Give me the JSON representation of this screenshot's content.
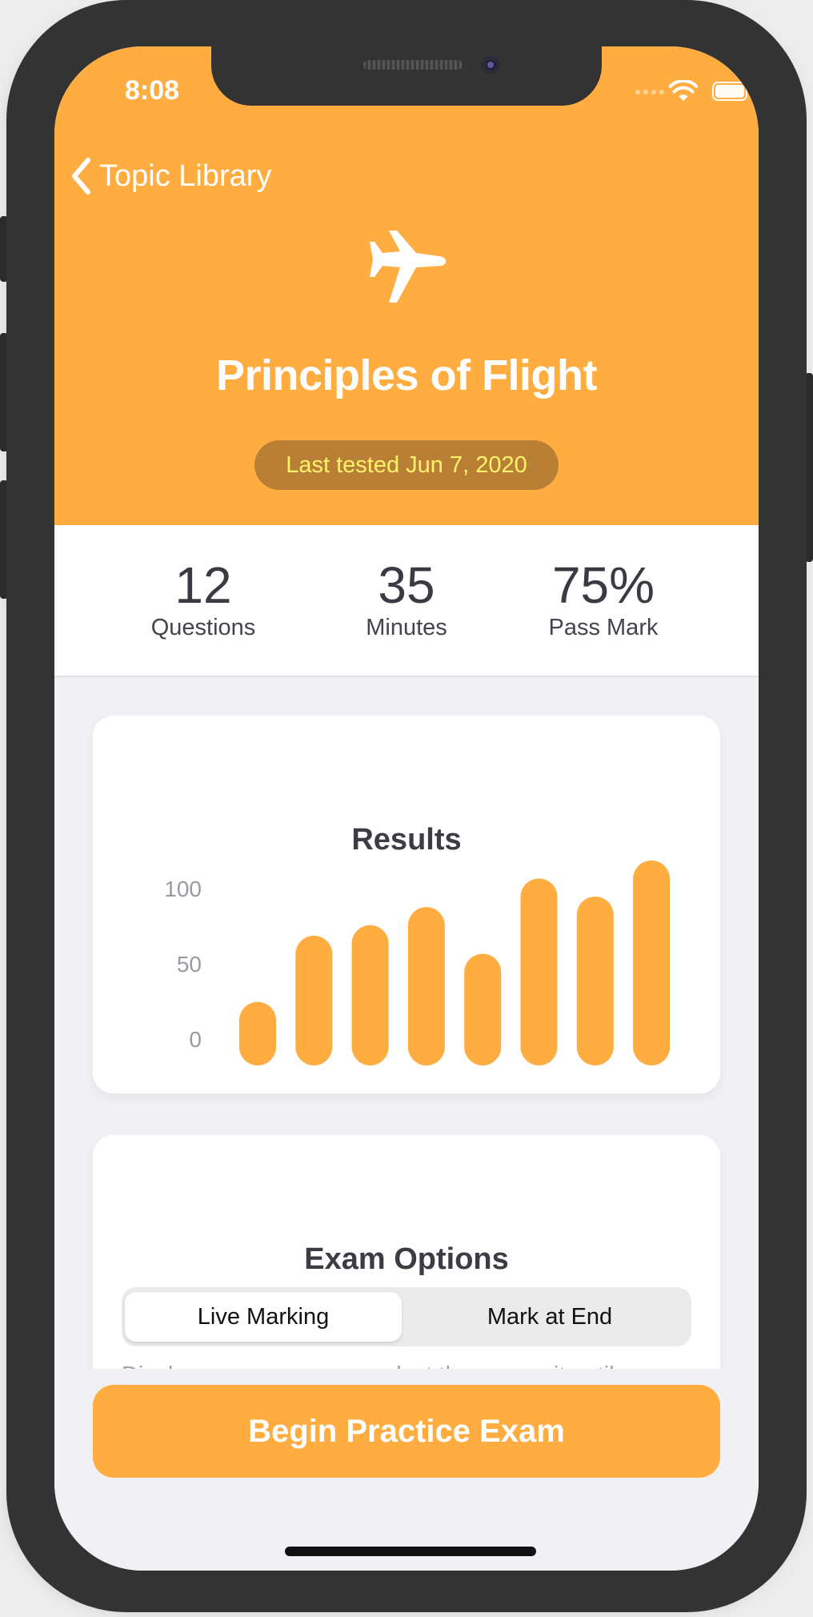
{
  "status_bar": {
    "time": "8:08"
  },
  "nav": {
    "back_label": "Topic Library"
  },
  "topic": {
    "icon": "airplane-icon",
    "title": "Principles of Flight",
    "last_tested": "Last tested Jun 7, 2020"
  },
  "stats": [
    {
      "value": "12",
      "label": "Questions"
    },
    {
      "value": "35",
      "label": "Minutes"
    },
    {
      "value": "75%",
      "label": "Pass Mark"
    }
  ],
  "results": {
    "title": "Results",
    "chart_data": {
      "type": "bar",
      "title": "Results",
      "xlabel": "",
      "ylabel": "",
      "ylim": [
        0,
        100
      ],
      "y_ticks": [
        "0",
        "50",
        "100"
      ],
      "values": [
        30,
        74,
        81,
        93,
        62,
        112,
        100,
        124
      ],
      "grid": false,
      "color": "#ffad40"
    }
  },
  "exam_options": {
    "title": "Exam Options",
    "segments": [
      "Live Marking",
      "Mark at End"
    ],
    "selected": "Live Marking",
    "description": "Display answers as you select them or wait until"
  },
  "primary_action": {
    "label": "Begin Practice Exam"
  },
  "colors": {
    "accent": "#ffad40",
    "badge_bg": "#b98035",
    "badge_text": "#fff36a",
    "phone_frame": "#333333",
    "screen_bg": "#f1f1f5"
  }
}
